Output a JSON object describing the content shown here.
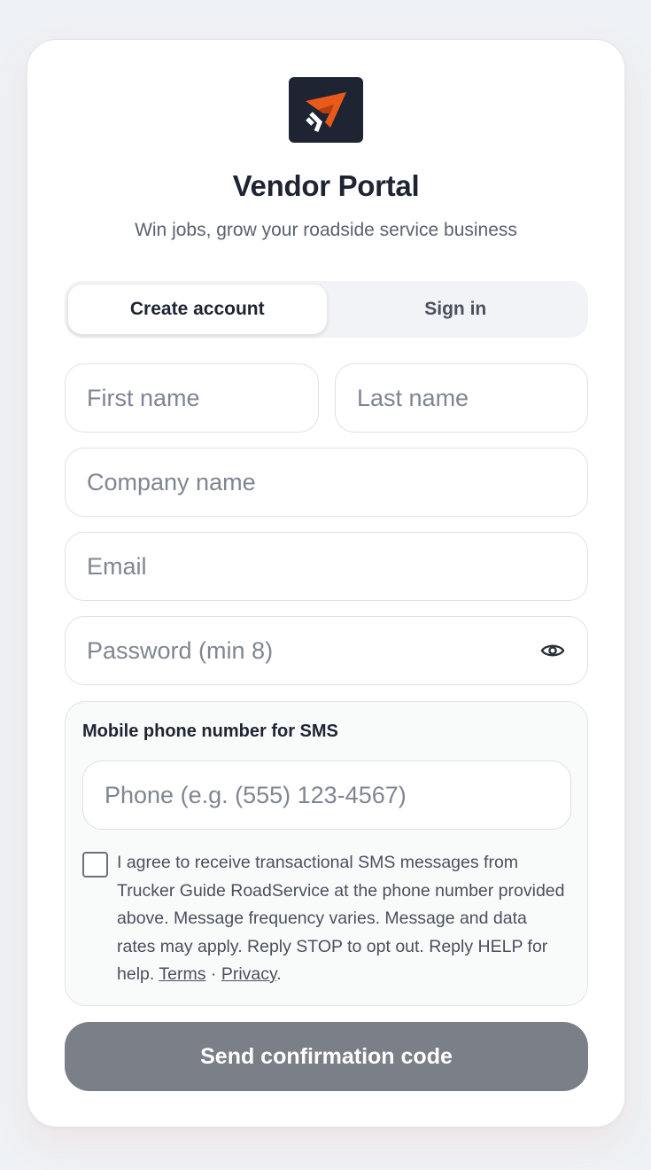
{
  "brand": {
    "title": "Vendor Portal",
    "subtitle": "Win jobs, grow your roadside service business",
    "logo_icon": "trucker-guide-logo",
    "logo_bg": "#1f2433",
    "accent": "#e8591a"
  },
  "tabs": [
    {
      "label": "Create account",
      "active": true
    },
    {
      "label": "Sign in",
      "active": false
    }
  ],
  "form": {
    "first_name": {
      "value": "",
      "placeholder": "First name"
    },
    "last_name": {
      "value": "",
      "placeholder": "Last name"
    },
    "company": {
      "value": "",
      "placeholder": "Company name"
    },
    "email": {
      "value": "",
      "placeholder": "Email"
    },
    "password": {
      "value": "",
      "placeholder": "Password (min 8)",
      "toggle_icon": "eye-icon"
    }
  },
  "sms": {
    "label": "Mobile phone number for SMS",
    "phone": {
      "value": "",
      "placeholder": "Phone (e.g. (555) 123-4567)"
    },
    "consent_checked": false,
    "consent_text": "I agree to receive transactional SMS messages from Trucker Guide RoadService at the phone number provided above. Message frequency varies. Message and data rates may apply. Reply STOP to opt out. Reply HELP for help.",
    "terms_label": "Terms",
    "separator": "·",
    "privacy_label": "Privacy",
    "end": "."
  },
  "submit": {
    "label": "Send confirmation code",
    "color": "#7b7f87"
  }
}
